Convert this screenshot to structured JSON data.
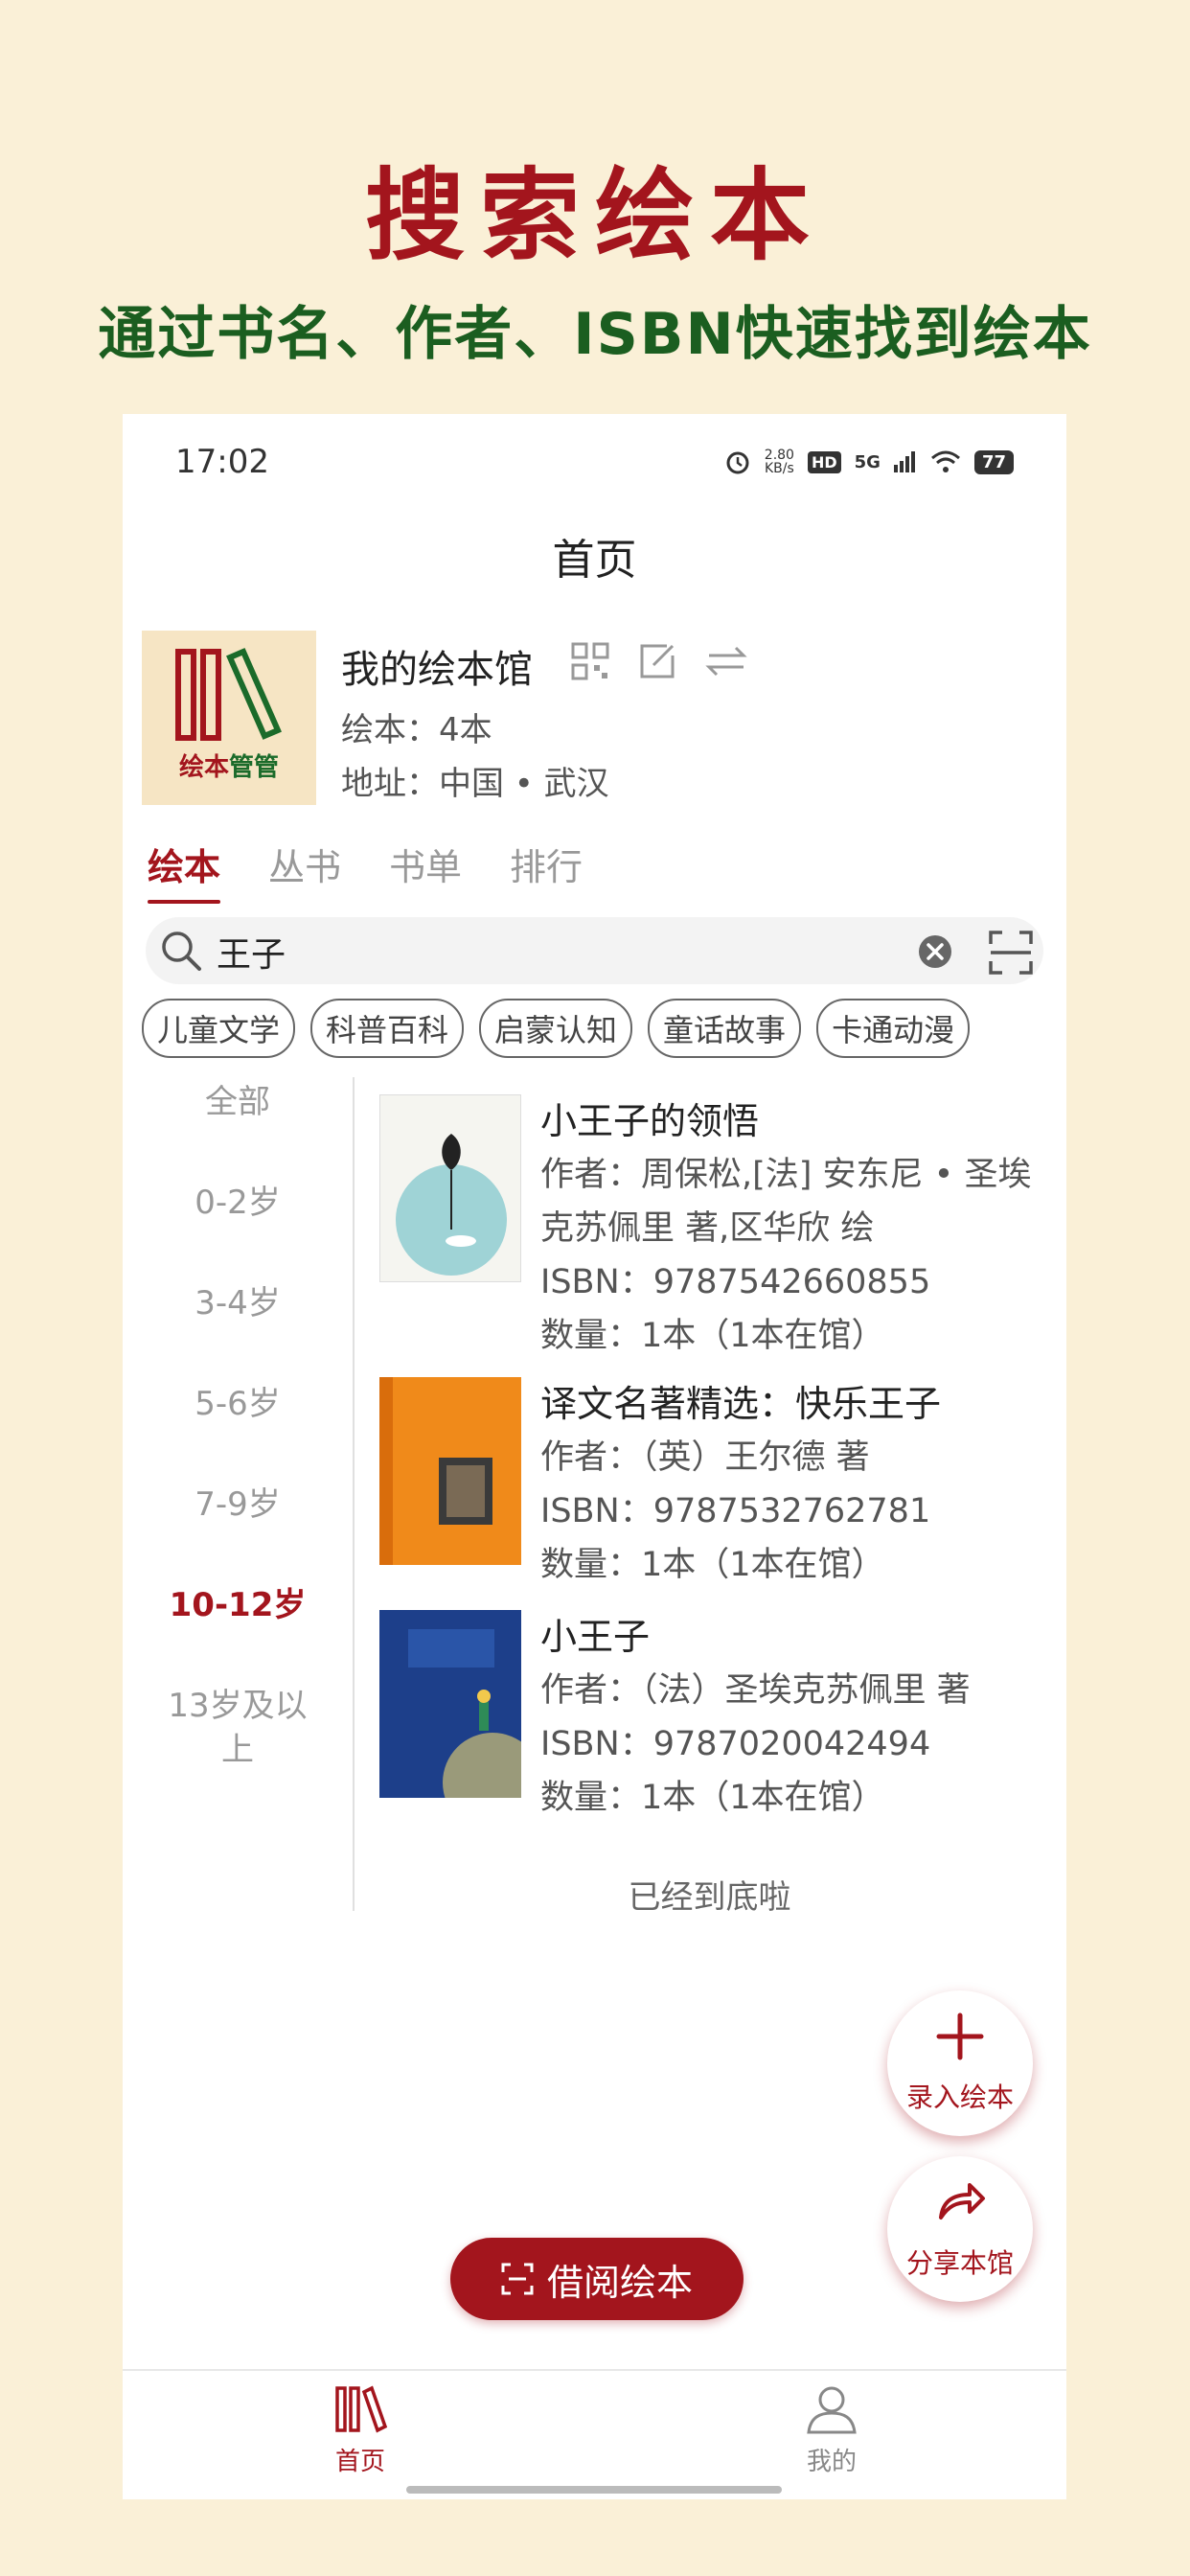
{
  "promo": {
    "headline": "搜索绘本",
    "subline": "通过书名、作者、ISBN快速找到绘本"
  },
  "status_bar": {
    "time": "17:02",
    "net_speed": "2.80",
    "net_unit": "KB/s",
    "hd": "HD",
    "signal": "5G",
    "battery": "77"
  },
  "page_title": "首页",
  "library": {
    "logo_text_red": "绘本",
    "logo_text_green": "管管",
    "name": "我的绘本馆",
    "count": "绘本：4本",
    "address": "地址：中国 • 武汉"
  },
  "tabs": [
    "绘本",
    "丛书",
    "书单",
    "排行"
  ],
  "search": {
    "query": "王子"
  },
  "chips": [
    "儿童文学",
    "科普百科",
    "启蒙认知",
    "童话故事",
    "卡通动漫"
  ],
  "ages": [
    "全部",
    "0-2岁",
    "3-4岁",
    "5-6岁",
    "7-9岁",
    "10-12岁",
    "13岁及以上"
  ],
  "active_age": "10-12岁",
  "books": [
    {
      "title": "小王子的领悟",
      "author": "作者：周保松,[法] 安东尼 • 圣埃克苏佩里 著,区华欣 绘",
      "isbn": "ISBN：9787542660855",
      "quantity": "数量：1本（1本在馆）"
    },
    {
      "title": "译文名著精选：快乐王子",
      "author": "作者：（英）王尔德 著",
      "isbn": "ISBN：9787532762781",
      "quantity": "数量：1本（1本在馆）"
    },
    {
      "title": "小王子",
      "author": "作者：（法）圣埃克苏佩里 著",
      "isbn": "ISBN：9787020042494",
      "quantity": "数量：1本（1本在馆）"
    }
  ],
  "end_text": "已经到底啦",
  "fab_add": "录入绘本",
  "fab_share": "分享本馆",
  "borrow_button": "借阅绘本",
  "nav": {
    "home": "首页",
    "mine": "我的"
  },
  "colors": {
    "accent": "#a3151d",
    "green": "#1b5e20",
    "background": "#faf0d7"
  }
}
